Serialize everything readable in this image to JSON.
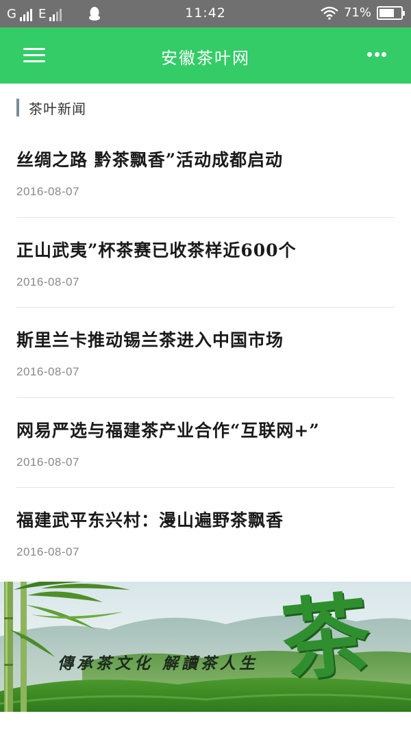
{
  "status_bar": {
    "network_1": "G",
    "network_2": "E",
    "time": "11:42",
    "battery_text": "71%",
    "battery_level": 0.71,
    "icons": [
      "signal-icon",
      "qq-icon",
      "wifi-icon",
      "battery-icon"
    ]
  },
  "app_bar": {
    "title": "安徽茶叶网",
    "accent_color": "#33cc66",
    "icons": [
      "menu-icon",
      "more-icon"
    ]
  },
  "section": {
    "title": "茶叶新闻"
  },
  "news": [
    {
      "title": "丝绸之路 黔茶飘香”活动成都启动",
      "date": "2016-08-07"
    },
    {
      "title": "正山武夷”杯茶赛已收茶样近600个",
      "date": "2016-08-07"
    },
    {
      "title": "斯里兰卡推动锡兰茶进入中国市场",
      "date": "2016-08-07"
    },
    {
      "title": "网易严选与福建茶产业合作“互联网+”",
      "date": "2016-08-07"
    },
    {
      "title": "福建武平东兴村：漫山遍野茶飘香",
      "date": "2016-08-07"
    }
  ],
  "banner": {
    "slogan": "傳承茶文化 解讀茶人生",
    "glyph": "茶"
  }
}
